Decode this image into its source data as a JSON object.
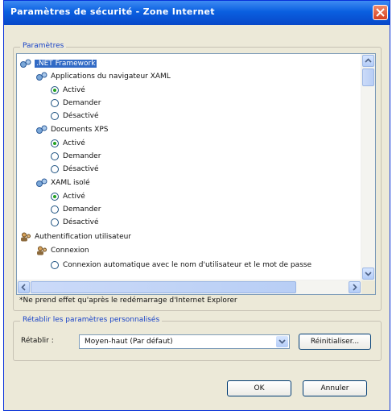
{
  "window": {
    "title": "Paramètres de sécurité - Zone Internet"
  },
  "settings_group": {
    "legend": "Paramètres"
  },
  "tree": {
    "items": [
      {
        "label": ".NET Framework"
      },
      {
        "label": "Applications du navigateur XAML"
      },
      {
        "label": "Activé"
      },
      {
        "label": "Demander"
      },
      {
        "label": "Désactivé"
      },
      {
        "label": "Documents XPS"
      },
      {
        "label": "Activé"
      },
      {
        "label": "Demander"
      },
      {
        "label": "Désactivé"
      },
      {
        "label": "XAML isolé"
      },
      {
        "label": "Activé"
      },
      {
        "label": "Demander"
      },
      {
        "label": "Désactivé"
      },
      {
        "label": "Authentification utilisateur"
      },
      {
        "label": "Connexion"
      },
      {
        "label": "Connexion automatique avec le nom d'utilisateur et le mot de passe"
      }
    ]
  },
  "note": "*Ne prend effet qu'après le redémarrage d'Internet Explorer",
  "reset_group": {
    "legend": "Rétablir les paramètres personnalisés",
    "label": "Rétablir :",
    "selected": "Moyen-haut (Par défaut)",
    "reset_button": "Réinitialiser..."
  },
  "footer": {
    "ok": "OK",
    "cancel": "Annuler"
  },
  "colors": {
    "titlebar": "#0a5fe0",
    "selection": "#316ac5",
    "radio_dot": "#21a121"
  },
  "icons": {
    "setting_category": "gear-cluster-icon",
    "user_auth": "users-icon"
  }
}
